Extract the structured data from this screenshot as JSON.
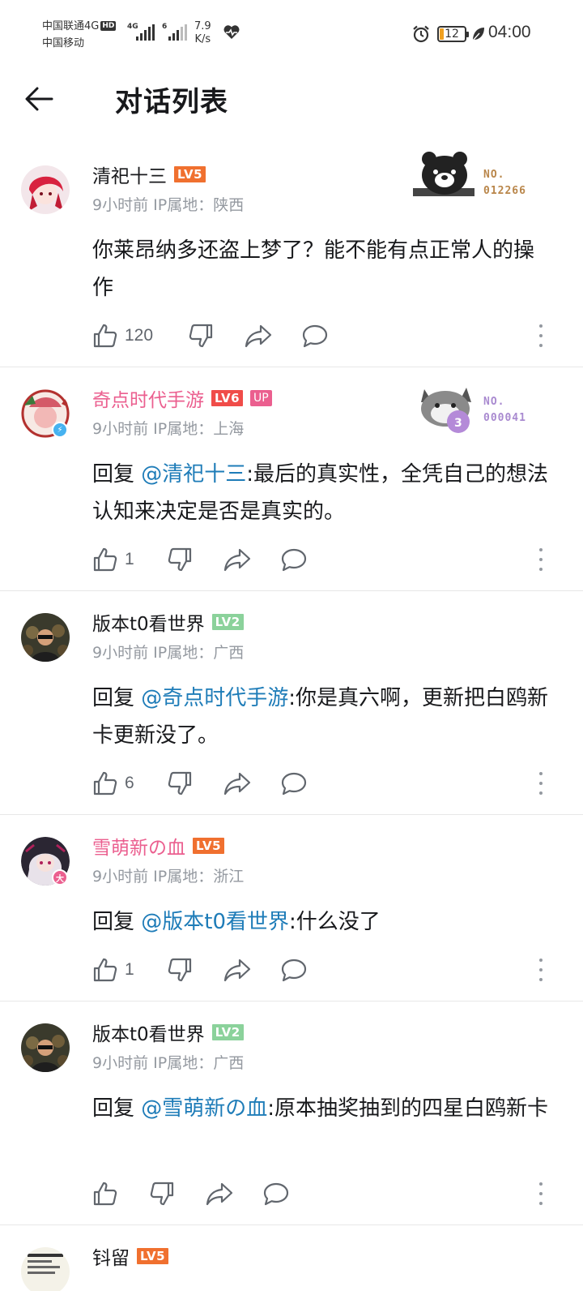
{
  "status_bar": {
    "carrier1": "中国联通4G",
    "hd": "HD",
    "carrier2": "中国移动",
    "net1": "4G",
    "net2": "6",
    "speed_value": "7.9",
    "speed_unit": "K/s",
    "battery": "12",
    "time": "04:00"
  },
  "header": {
    "title": "对话列表"
  },
  "comments": [
    {
      "name": "清祀十三",
      "level": "LV5",
      "meta": "9小时前  IP属地：陕西",
      "text": "你莱昂纳多还盗上梦了？能不能有点正常人的操作",
      "likes": "120",
      "fan_no_label": "NO.",
      "fan_no": "012266"
    },
    {
      "name": "奇点时代手游",
      "level": "LV6",
      "up": "UP",
      "meta": "9小时前  IP属地：上海",
      "reply_prefix": "回复 ",
      "mention": "@清祀十三",
      "text": ":最后的真实性，全凭自己的想法认知来决定是否是真实的。",
      "likes": "1",
      "fan_no_label": "NO.",
      "fan_no": "000041"
    },
    {
      "name": "版本t0看世界",
      "level": "LV2",
      "meta": "9小时前  IP属地：广西",
      "reply_prefix": "回复 ",
      "mention": "@奇点时代手游",
      "text": ":你是真六啊，更新把白鸥新卡更新没了。",
      "likes": "6"
    },
    {
      "name": "雪萌新の血",
      "level": "LV5",
      "meta": "9小时前  IP属地：浙江",
      "reply_prefix": "回复 ",
      "mention": "@版本t0看世界",
      "text": ":什么没了",
      "likes": "1"
    },
    {
      "name": "版本t0看世界",
      "level": "LV2",
      "meta": "9小时前  IP属地：广西",
      "reply_prefix": "回复 ",
      "mention": "@雪萌新の血",
      "text": ":原本抽奖抽到的四星白鸥新卡",
      "likes": ""
    },
    {
      "name": "钭留",
      "level": "LV5"
    }
  ],
  "colors": {
    "lv5": "#f0702f",
    "lv6": "#f04c49",
    "lv2": "#8bd29b",
    "vip_name": "#eb5f8f",
    "mention": "#1e7cb8",
    "meta": "#9499a0"
  }
}
